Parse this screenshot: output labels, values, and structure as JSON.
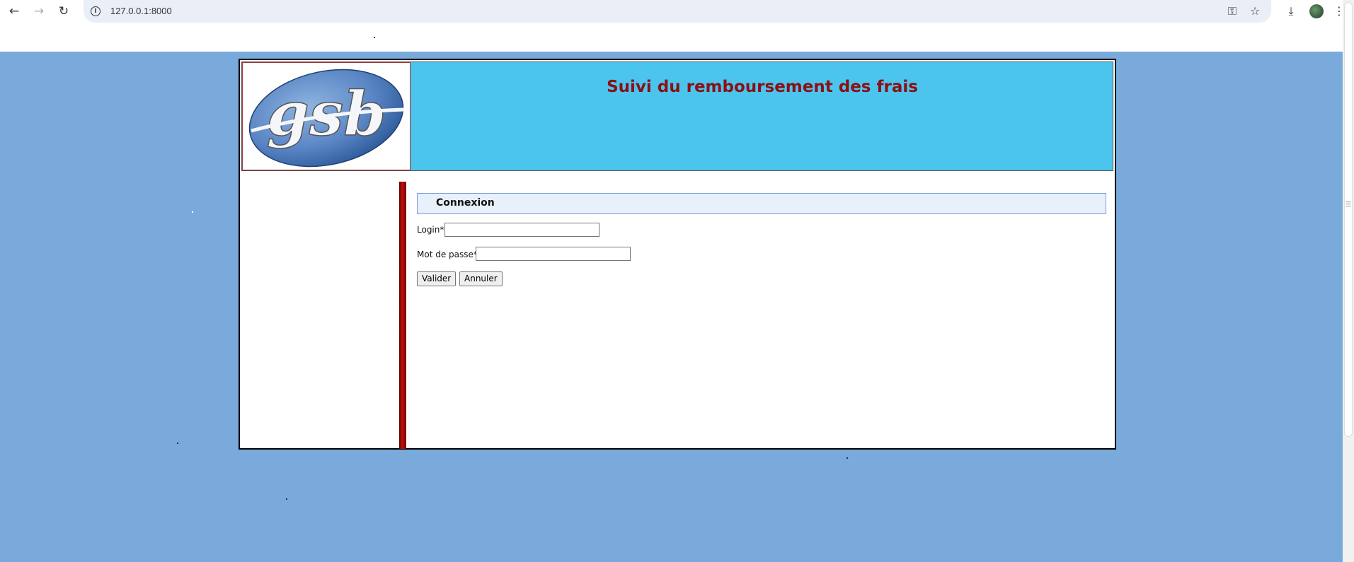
{
  "browser": {
    "back_icon": "←",
    "forward_icon": "→",
    "reload_icon": "↻",
    "info_icon": "i",
    "url": "127.0.0.1:8000",
    "password_icon": "⚿",
    "star_icon": "☆",
    "download_icon": "⤓",
    "menu_icon": "⋮"
  },
  "header": {
    "title": "Suivi du remboursement des frais",
    "logo_text": "gsb"
  },
  "login": {
    "section_title": "Connexion",
    "login_label": "Login*",
    "login_value": "",
    "password_label": "Mot de passe*",
    "password_value": "",
    "submit_label": "Valider",
    "reset_label": "Annuler"
  },
  "colors": {
    "page_background": "#79aadb",
    "header_background": "#4bc5ee",
    "title_color": "#8b0f14",
    "divider_color": "#8b0000"
  }
}
